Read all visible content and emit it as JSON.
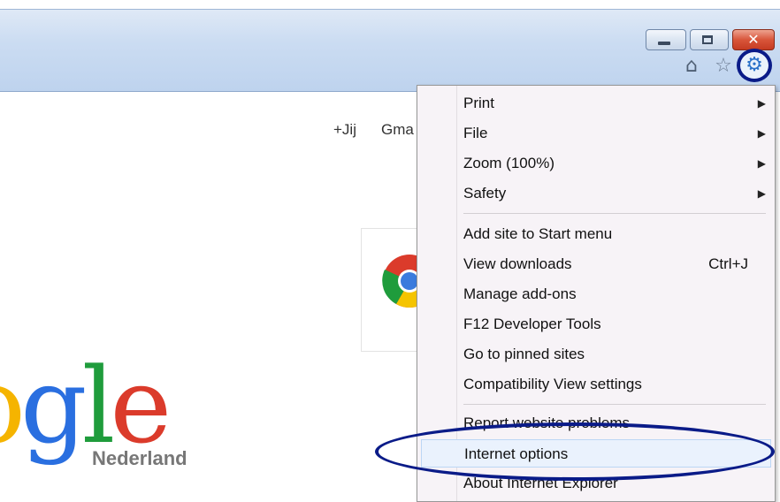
{
  "window": {
    "controls": {
      "minimize": "minimize",
      "maximize": "maximize",
      "close": "close",
      "close_glyph": "✕"
    },
    "command_icons": [
      "home-icon",
      "star-icon",
      "gear-icon"
    ]
  },
  "page": {
    "links": [
      "+Jij",
      "Gma"
    ],
    "google": {
      "letters": [
        "o",
        "g",
        "l",
        "e"
      ],
      "country": "Nederland"
    },
    "tile_icon": "chrome-icon"
  },
  "menu": {
    "items": [
      {
        "label": "Print",
        "submenu": true
      },
      {
        "label": "File",
        "submenu": true
      },
      {
        "label": "Zoom (100%)",
        "submenu": true
      },
      {
        "label": "Safety",
        "submenu": true
      },
      {
        "label": "Add site to Start menu"
      },
      {
        "label": "View downloads",
        "shortcut": "Ctrl+J"
      },
      {
        "label": "Manage add-ons"
      },
      {
        "label": "F12 Developer Tools"
      },
      {
        "label": "Go to pinned sites"
      },
      {
        "label": "Compatibility View settings"
      },
      {
        "label": "Report website problems"
      },
      {
        "label": "Internet options",
        "highlighted": true
      },
      {
        "label": "About Internet Explorer"
      }
    ],
    "arrow_glyph": "▶"
  },
  "annotation_color": "#0a1b88",
  "accent_color": "#2a71c9"
}
